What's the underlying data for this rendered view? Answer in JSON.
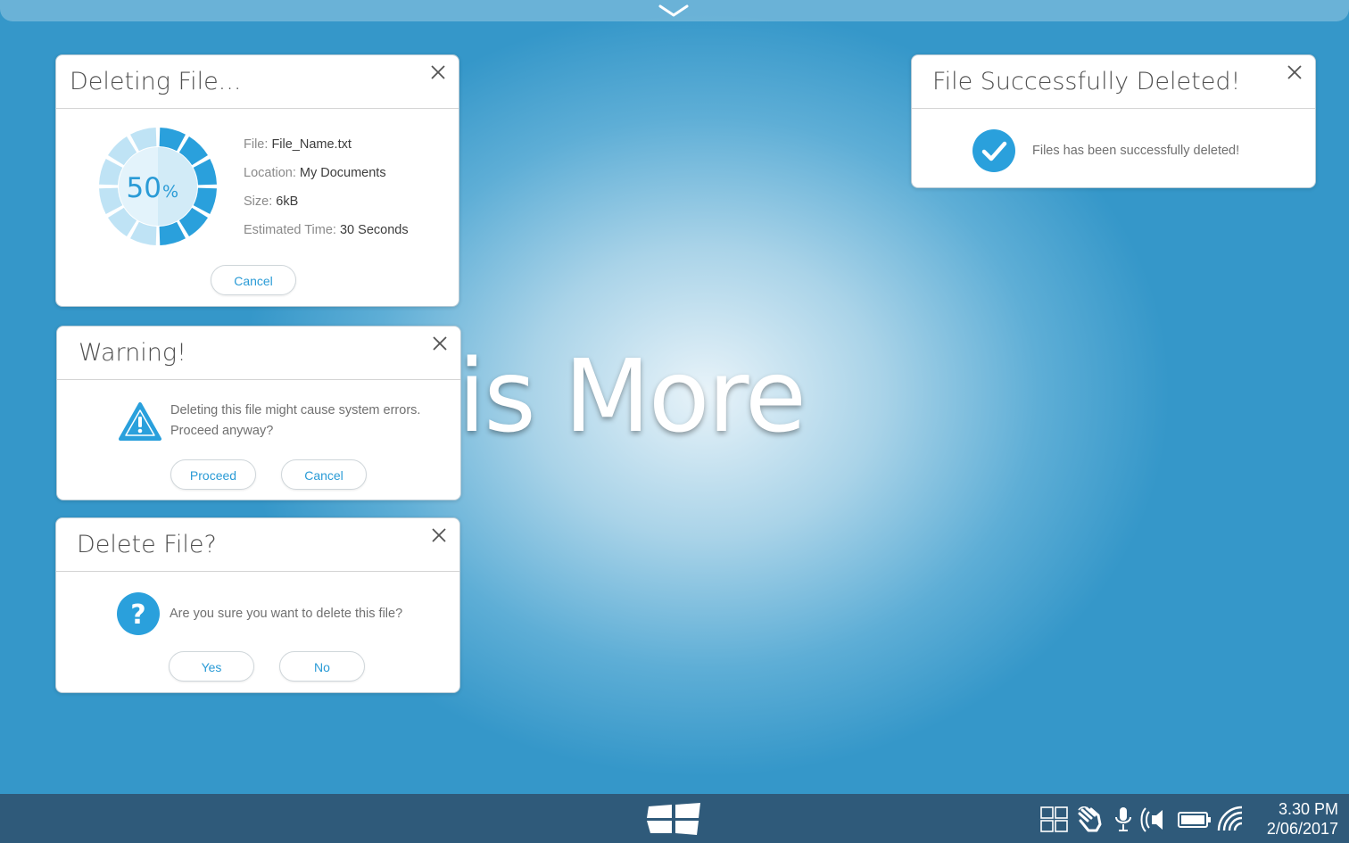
{
  "wallpaper": {
    "text": "ess is More"
  },
  "deleting_dialog": {
    "title": "Deleting File...",
    "progress_percent": 50,
    "progress_number": "50",
    "progress_unit": "%",
    "rows": [
      {
        "label": "File:",
        "value": "File_Name.txt"
      },
      {
        "label": "Location:",
        "value": "My Documents"
      },
      {
        "label": "Size:",
        "value": "6kB"
      },
      {
        "label": "Estimated Time:",
        "value": "30 Seconds"
      }
    ],
    "cancel_label": "Cancel"
  },
  "warning_dialog": {
    "title": "Warning!",
    "message_line1": "Deleting this file might cause system errors.",
    "message_line2": "Proceed anyway?",
    "proceed_label": "Proceed",
    "cancel_label": "Cancel"
  },
  "confirm_dialog": {
    "title": "Delete File?",
    "message": "Are you sure you want to delete this file?",
    "yes_label": "Yes",
    "no_label": "No"
  },
  "success_dialog": {
    "title": "File Successfully Deleted!",
    "message": "Files has been successfully deleted!"
  },
  "taskbar": {
    "time": "3.30 PM",
    "date": "2/06/2017",
    "icons": [
      "windows-start-icon",
      "task-view-icon",
      "touch-hand-icon",
      "microphone-icon",
      "volume-icon",
      "battery-icon",
      "wifi-icon"
    ]
  },
  "colors": {
    "accent": "#2a9bd6",
    "icon_blue": "#2aa0dc",
    "taskbar": "#2f5a7a",
    "ring_full": "#2aa0dc",
    "ring_light": "#bfe3f5"
  }
}
